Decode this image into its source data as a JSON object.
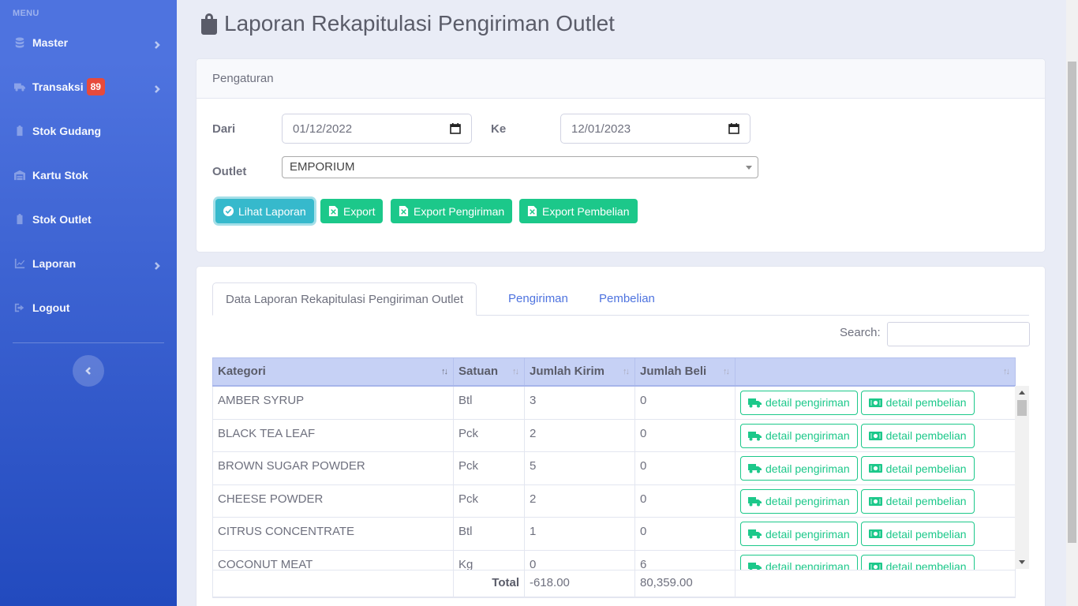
{
  "sidebar": {
    "menu_heading": "MENU",
    "items": [
      {
        "label": "Master",
        "icon": "database-icon",
        "has_chevron": true
      },
      {
        "label": "Transaksi",
        "icon": "truck-icon",
        "badge": "89",
        "has_chevron": true
      },
      {
        "label": "Stok Gudang",
        "icon": "clipboard-icon"
      },
      {
        "label": "Kartu Stok",
        "icon": "warehouse-icon"
      },
      {
        "label": "Stok Outlet",
        "icon": "clipboard-icon"
      },
      {
        "label": "Laporan",
        "icon": "chart-line-icon",
        "has_chevron": true
      },
      {
        "label": "Logout",
        "icon": "sign-out-icon"
      }
    ]
  },
  "page": {
    "title": "Laporan Rekapitulasi Pengiriman Outlet",
    "title_icon": "shopping-bag-icon"
  },
  "settings": {
    "header": "Pengaturan",
    "from_label": "Dari",
    "from_value": "01/12/2022",
    "to_label": "Ke",
    "to_value": "12/01/2023",
    "outlet_label": "Outlet",
    "outlet_value": "EMPORIUM",
    "buttons": {
      "view": "Lihat Laporan",
      "export": "Export",
      "export_shipping": "Export Pengiriman",
      "export_purchase": "Export Pembelian"
    }
  },
  "report": {
    "tabs": [
      "Data Laporan Rekapitulasi Pengiriman Outlet",
      "Pengiriman",
      "Pembelian"
    ],
    "search_label": "Search:",
    "columns": [
      "Kategori",
      "Satuan",
      "Jumlah Kirim",
      "Jumlah Beli",
      ""
    ],
    "rows": [
      {
        "kategori": "AMBER SYRUP",
        "satuan": "Btl",
        "kirim": "3",
        "beli": "0"
      },
      {
        "kategori": "BLACK TEA LEAF",
        "satuan": "Pck",
        "kirim": "2",
        "beli": "0"
      },
      {
        "kategori": "BROWN SUGAR POWDER",
        "satuan": "Pck",
        "kirim": "5",
        "beli": "0"
      },
      {
        "kategori": "CHEESE POWDER",
        "satuan": "Pck",
        "kirim": "2",
        "beli": "0"
      },
      {
        "kategori": "CITRUS CONCENTRATE",
        "satuan": "Btl",
        "kirim": "1",
        "beli": "0"
      },
      {
        "kategori": "COCONUT MEAT",
        "satuan": "Kg",
        "kirim": "0",
        "beli": "6"
      }
    ],
    "row_buttons": {
      "shipping": "detail pengiriman",
      "purchase": "detail pembelian"
    },
    "footer": {
      "label": "Total",
      "kirim_total": "-618.00",
      "beli_total": "80,359.00"
    }
  }
}
